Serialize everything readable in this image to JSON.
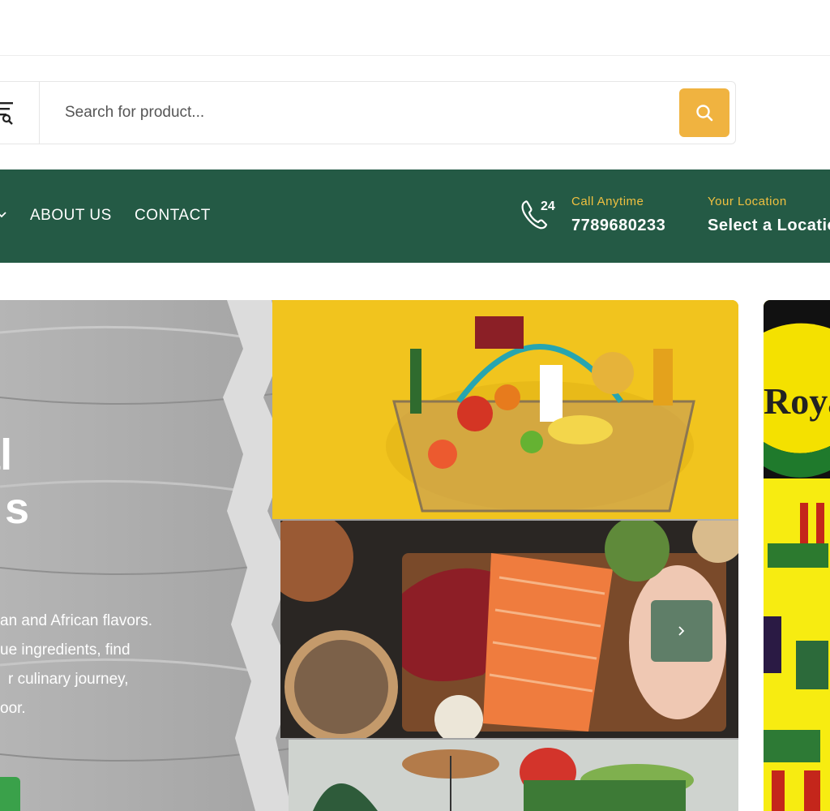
{
  "search": {
    "placeholder": "Search for product..."
  },
  "nav": {
    "links": [
      "ABOUT US",
      "CONTACT"
    ],
    "call": {
      "label": "Call Anytime",
      "number": "7789680233",
      "badge": "24"
    },
    "location": {
      "label": "Your Location",
      "value": "Select a Locatio"
    }
  },
  "hero": {
    "title_lines": [
      "yal",
      "s"
    ],
    "description_lines": [
      "an and African flavors.",
      "ue ingredients, find",
      "r culinary journey,",
      "oor."
    ]
  },
  "side_banner": {
    "text": "Roya"
  },
  "icons": {
    "filter": "filter-search-icon",
    "search": "search-icon",
    "chevron": "chevron-down-icon",
    "phone": "phone-24-icon",
    "next": "chevron-right-icon"
  },
  "colors": {
    "nav_bg": "#245a45",
    "accent_yellow": "#f0b340",
    "label_gold": "#f0c040",
    "button_green": "#3aa14a"
  }
}
